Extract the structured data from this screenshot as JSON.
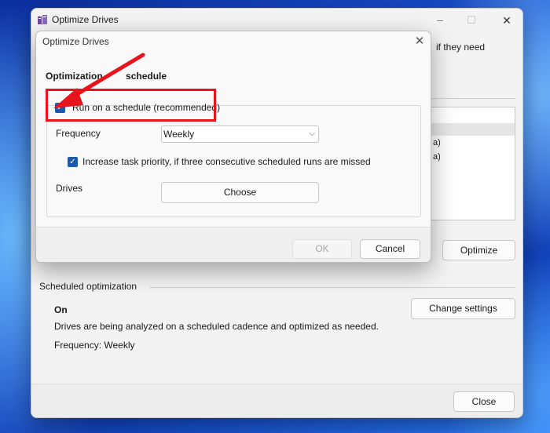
{
  "main_window": {
    "title": "Optimize Drives",
    "controls": {
      "minimize": "–",
      "maximize": "☐",
      "close": "✕"
    },
    "bg_text": "if they need",
    "drive_rows": [
      "a)",
      "a)",
      "a)"
    ],
    "optimize_label": "Optimize",
    "scheduled": {
      "heading": "Scheduled optimization",
      "status": "On",
      "description": "Drives are being analyzed on a scheduled cadence and optimized as needed.",
      "frequency": "Frequency: Weekly",
      "change_settings_label": "Change settings"
    },
    "close_label": "Close"
  },
  "dialog": {
    "title": "Optimize Drives",
    "close_glyph": "✕",
    "heading_part1": "Optimization",
    "heading_part2": "schedule",
    "run_on_schedule": {
      "checked": true,
      "label": "Run on a schedule (recommended)"
    },
    "frequency_label": "Frequency",
    "frequency_value": "Weekly",
    "increase_priority": {
      "checked": true,
      "label": "Increase task priority, if three consecutive scheduled runs are missed"
    },
    "drives_label": "Drives",
    "choose_label": "Choose",
    "ok_label": "OK",
    "cancel_label": "Cancel"
  },
  "icons": {
    "checkmark": "✓",
    "chevron": "⌵"
  },
  "colors": {
    "accent": "#1e5aa8",
    "annotation": "#e8141c"
  }
}
